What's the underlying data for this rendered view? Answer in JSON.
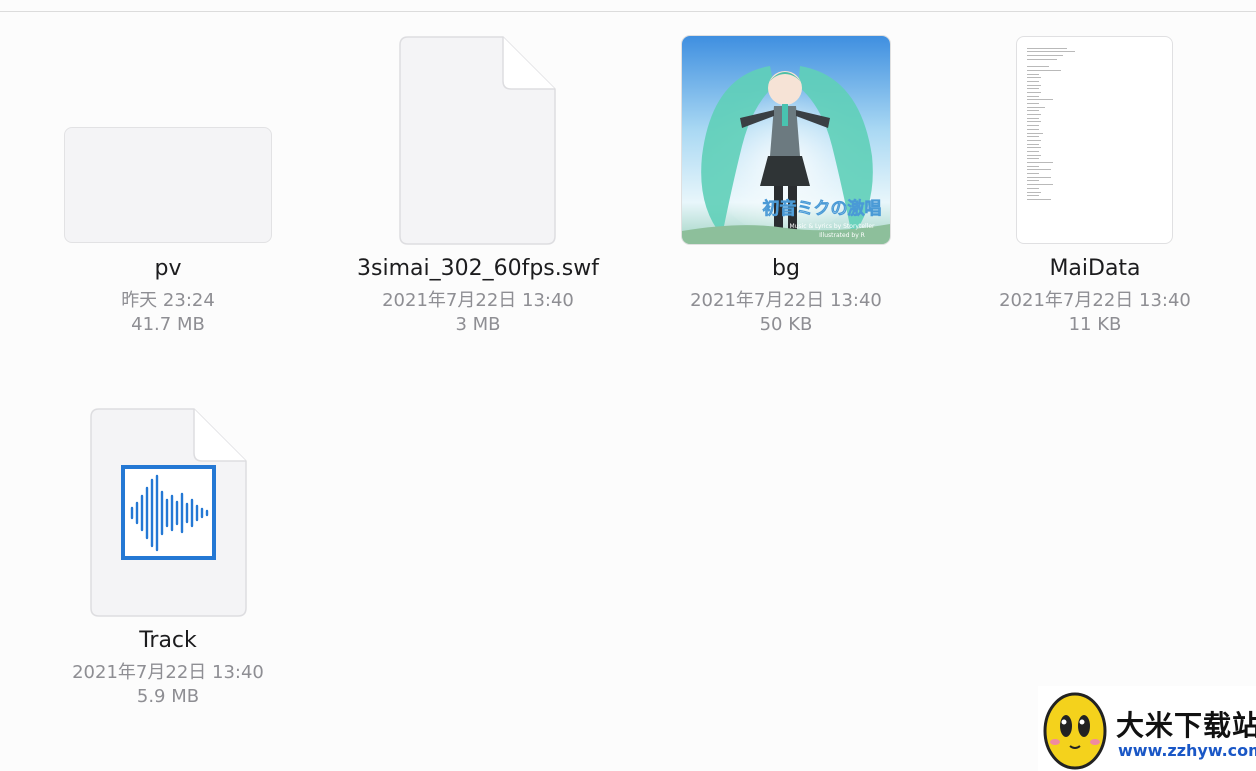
{
  "files": [
    {
      "name": "pv",
      "date": "昨天 23:24",
      "size": "41.7 MB",
      "icon": "folder-icon"
    },
    {
      "name": "3simai_302_60fps.swf",
      "date": "2021年7月22日 13:40",
      "size": "3 MB",
      "icon": "document-icon"
    },
    {
      "name": "bg",
      "date": "2021年7月22日 13:40",
      "size": "50 KB",
      "icon": "image-thumbnail",
      "thumbnail_text": {
        "title": "初音ミクの激唱",
        "credit1": "Music & Lyrics by Storyteller",
        "credit2": "Illustrated by R"
      }
    },
    {
      "name": "MaiData",
      "date": "2021年7月22日 13:40",
      "size": "11 KB",
      "icon": "text-document-icon"
    },
    {
      "name": "Track",
      "date": "2021年7月22日 13:40",
      "size": "5.9 MB",
      "icon": "audio-waveform-icon"
    }
  ],
  "watermark": {
    "brand": "大米下载站",
    "url": "www.zzhyw.com"
  },
  "colors": {
    "accent": "#2478d4",
    "secondary_text": "#8e8e93",
    "background": "#fcfcfc"
  }
}
